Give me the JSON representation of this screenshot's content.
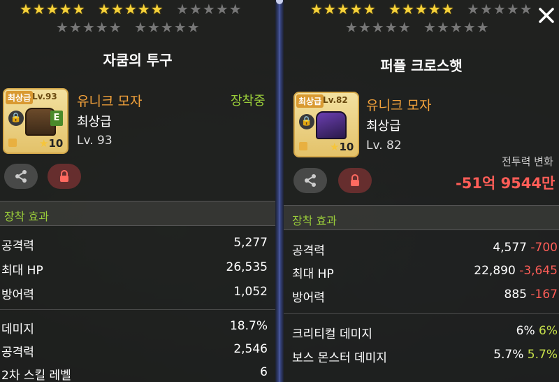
{
  "stars": {
    "left_row1": "★★★★★",
    "left_row1b": "★★★★★",
    "left_row1c": "★★★★★",
    "left_row2": "★★★★★",
    "left_row2b": "★★★★★",
    "right_row1": "★★★★★",
    "right_row1b": "★★★★★",
    "right_row1c": "★★★★★",
    "right_row2": "★★★★★",
    "right_row2b": "★★★★★"
  },
  "left": {
    "title": "자쿰의 투구",
    "icon": {
      "grade": "최상급",
      "level": "Lv.93",
      "stars": "10",
      "letter": "E"
    },
    "name": "유니크 모자",
    "grade": "최상급",
    "level": "Lv. 93",
    "equipped": "장착중",
    "section_title": "장착 효과",
    "stats": [
      {
        "label": "공격력",
        "value": "5,277"
      },
      {
        "label": "최대 HP",
        "value": "26,535"
      },
      {
        "label": "방어력",
        "value": "1,052"
      }
    ],
    "extra_stats": [
      {
        "label": "데미지",
        "value": "18.7%"
      },
      {
        "label": "공격력",
        "value": "2,546"
      },
      {
        "label": "2차 스킬 레벨",
        "value": "6"
      }
    ]
  },
  "right": {
    "title": "퍼플 크로스햇",
    "icon": {
      "grade": "최상급",
      "level": "Lv.82",
      "stars": "10"
    },
    "name": "유니크 모자",
    "grade": "최상급",
    "level": "Lv. 82",
    "power_label": "전투력 변화",
    "power_value": "-51억 9544만",
    "section_title": "장착 효과",
    "stats": [
      {
        "label": "공격력",
        "value": "4,577",
        "diff": "-700"
      },
      {
        "label": "최대 HP",
        "value": "22,890",
        "diff": "-3,645"
      },
      {
        "label": "방어력",
        "value": "885",
        "diff": "-167"
      }
    ],
    "extra_stats": [
      {
        "label": "크리티컬 데미지",
        "value": "6%",
        "diff": "6%"
      },
      {
        "label": "보스 몬스터 데미지",
        "value": "5.7%",
        "diff": "5.7%"
      }
    ]
  },
  "colors": {
    "accent_orange": "#f3a23b",
    "green": "#9acd3a",
    "red": "#ff5d57"
  },
  "icons": [
    "share-icon",
    "lock-icon",
    "close-icon",
    "star-icon"
  ]
}
